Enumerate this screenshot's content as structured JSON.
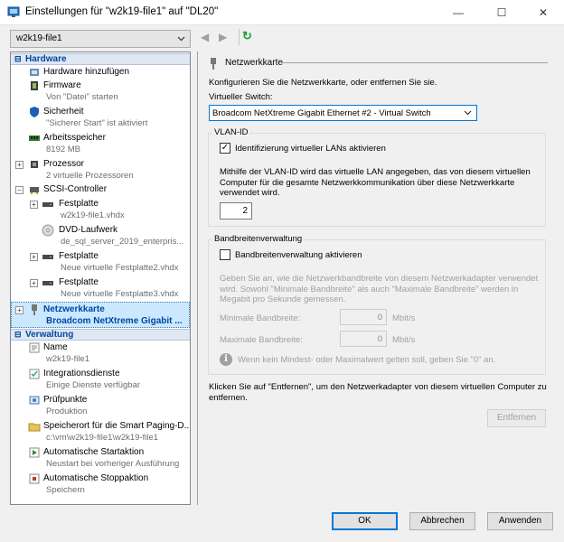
{
  "window": {
    "title": "Einstellungen für \"w2k19-file1\" auf \"DL20\"",
    "minimize_glyph": "—",
    "maximize_glyph": "☐",
    "close_glyph": "✕"
  },
  "toolbar": {
    "vm_selected": "w2k19-file1",
    "back_glyph": "◀",
    "forward_glyph": "▶",
    "refresh_glyph": "↻"
  },
  "sidebar": {
    "hardware_header": "Hardware",
    "management_header": "Verwaltung",
    "collapse_glyph": "⊟",
    "items": [
      {
        "label": "Hardware hinzufügen",
        "sub": "",
        "icon": "add-hardware-icon"
      },
      {
        "label": "Firmware",
        "sub": "Von \"Datei\" starten",
        "icon": "firmware-icon"
      },
      {
        "label": "Sicherheit",
        "sub": "\"Sicherer Start\" ist aktiviert",
        "icon": "shield-icon"
      },
      {
        "label": "Arbeitsspeicher",
        "sub": "8192 MB",
        "icon": "memory-icon"
      },
      {
        "label": "Prozessor",
        "sub": "2 virtuelle Prozessoren",
        "icon": "processor-icon"
      },
      {
        "label": "SCSI-Controller",
        "sub": "",
        "icon": "controller-icon"
      },
      {
        "label": "Festplatte",
        "sub": "w2k19-file1.vhdx",
        "icon": "harddisk-icon"
      },
      {
        "label": "DVD-Laufwerk",
        "sub": "de_sql_server_2019_enterpris...",
        "icon": "dvd-icon"
      },
      {
        "label": "Festplatte",
        "sub": "Neue virtuelle Festplatte2.vhdx",
        "icon": "harddisk-icon"
      },
      {
        "label": "Festplatte",
        "sub": "Neue virtuelle Festplatte3.vhdx",
        "icon": "harddisk-icon"
      },
      {
        "label": "Netzwerkkarte",
        "sub": "Broadcom NetXtreme Gigabit ...",
        "icon": "network-adapter-icon"
      }
    ],
    "management_items": [
      {
        "label": "Name",
        "sub": "w2k19-file1",
        "icon": "name-icon"
      },
      {
        "label": "Integrationsdienste",
        "sub": "Einige Dienste verfügbar",
        "icon": "integration-icon"
      },
      {
        "label": "Prüfpunkte",
        "sub": "Produktion",
        "icon": "checkpoint-icon"
      },
      {
        "label": "Speicherort für die Smart Paging-D...",
        "sub": "c:\\vm\\w2k19-file1\\w2k19-file1",
        "icon": "smart-paging-icon"
      },
      {
        "label": "Automatische Startaktion",
        "sub": "Neustart bei vorheriger Ausführung",
        "icon": "autostart-icon"
      },
      {
        "label": "Automatische Stoppaktion",
        "sub": "Speichern",
        "icon": "autostop-icon"
      }
    ]
  },
  "main": {
    "section_title": "Netzwerkkarte",
    "intro": "Konfigurieren Sie die Netzwerkkarte, oder entfernen Sie sie.",
    "switch_label": "Virtueller Switch:",
    "switch_value": "Broadcom NetXtreme Gigabit Ethernet #2 - Virtual Switch",
    "vlan": {
      "legend": "VLAN-ID",
      "checkbox_label": "Identifizierung virtueller LANs aktivieren",
      "checked": true,
      "check_glyph": "✓",
      "desc": "Mithilfe der VLAN-ID wird das virtuelle LAN angegeben, das von diesem virtuellen Computer für die gesamte Netzwerkkommunikation über diese Netzwerkkarte verwendet wird.",
      "value": "2"
    },
    "bandwidth": {
      "legend": "Bandbreitenverwaltung",
      "checkbox_label": "Bandbreitenverwaltung aktivieren",
      "checked": false,
      "desc": "Geben Sie an, wie die Netzwerkbandbreite von diesem Netzwerkadapter verwendet wird. Sowohl \"Minimale Bandbreite\" als auch \"Maximale Bandbreite\" werden in Megabit pro Sekunde gemessen.",
      "min_label": "Minimale Bandbreite:",
      "min_value": "0",
      "max_label": "Maximale Bandbreite:",
      "max_value": "0",
      "unit": "Mbit/s",
      "info_glyph": "i",
      "info": "Wenn kein Mindest- oder Maximalwert gelten soll, geben Sie \"0\" an."
    },
    "remove_text": "Klicken Sie auf \"Entfernen\", um den Netzwerkadapter von diesem virtuellen Computer zu entfernen.",
    "remove_button": "Entfernen"
  },
  "footer": {
    "ok": "OK",
    "cancel": "Abbrechen",
    "apply": "Anwenden"
  }
}
